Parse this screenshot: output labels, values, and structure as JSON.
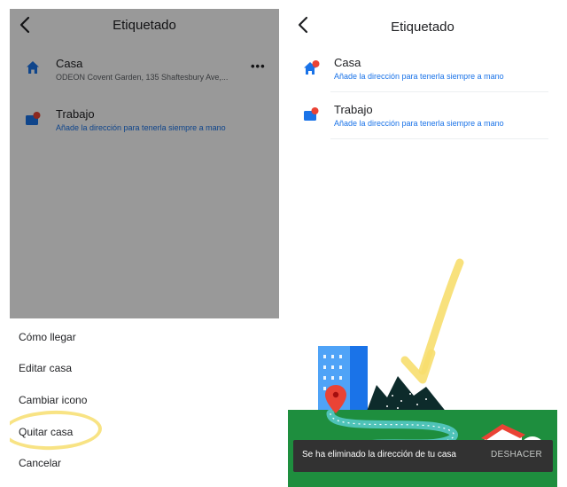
{
  "left": {
    "header": {
      "title": "Etiquetado"
    },
    "items": [
      {
        "name": "Casa",
        "subtitle": "ODEON Covent Garden, 135 Shaftesbury Ave,...",
        "icon": "home-icon"
      },
      {
        "name": "Trabajo",
        "subtitle": "Añade la dirección para tenerla siempre a mano",
        "icon": "work-icon"
      }
    ],
    "more_icon": "more-horizontal-icon",
    "sheet": {
      "options": [
        "Cómo llegar",
        "Editar casa",
        "Cambiar icono",
        "Quitar casa",
        "Cancelar"
      ]
    }
  },
  "right": {
    "header": {
      "title": "Etiquetado"
    },
    "items": [
      {
        "name": "Casa",
        "subtitle": "Añade la dirección para tenerla siempre a mano",
        "icon": "home-icon"
      },
      {
        "name": "Trabajo",
        "subtitle": "Añade la dirección para tenerla siempre a mano",
        "icon": "work-icon"
      }
    ],
    "snackbar": {
      "message": "Se ha eliminado la dirección de tu casa",
      "action": "DESHACER"
    }
  },
  "colors": {
    "accent_blue": "#1a73e8",
    "marker_red": "#ea4335",
    "snackbar_bg": "#323232",
    "highlight_yellow": "#f7de6e"
  }
}
